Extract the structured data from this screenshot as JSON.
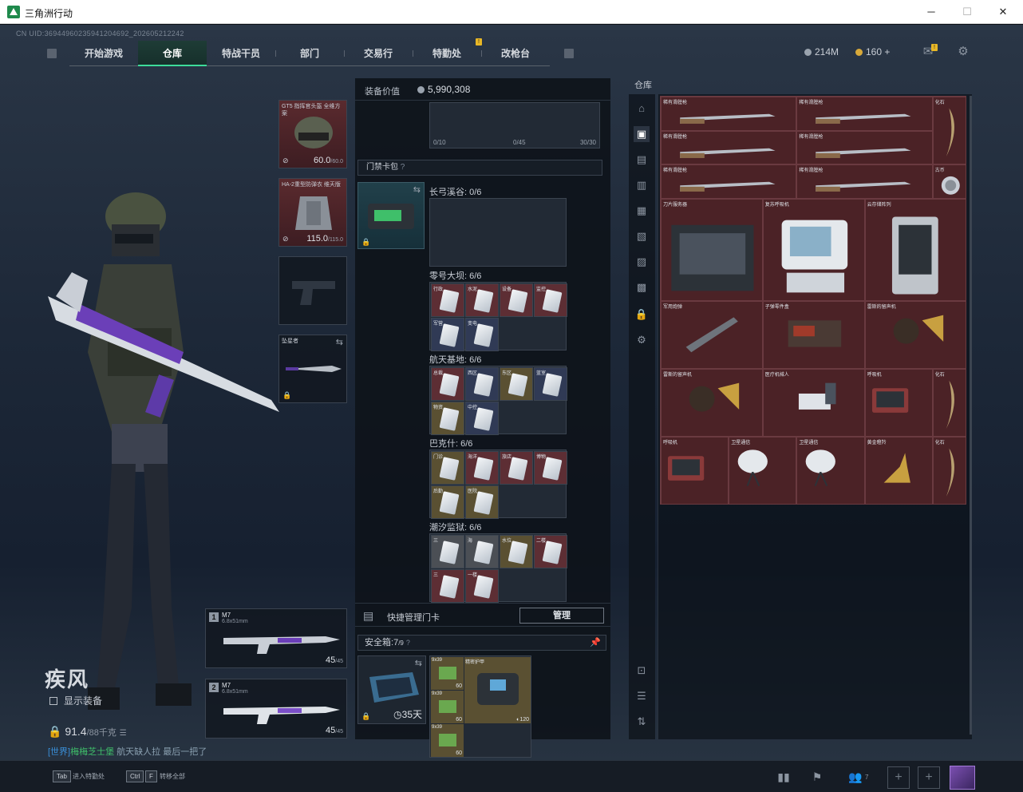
{
  "window": {
    "title": "三角洲行动",
    "minimize": "─",
    "maximize": "☐",
    "close": "✕"
  },
  "uid": "CN UID:3694496023594120469​2_202605212242",
  "nav": {
    "tabs": [
      {
        "label": "开始游戏"
      },
      {
        "label": "仓库"
      },
      {
        "label": "特战干员"
      },
      {
        "label": "部门"
      },
      {
        "label": "交易行"
      },
      {
        "label": "特勤处"
      },
      {
        "label": "改枪台"
      }
    ],
    "badge": "!"
  },
  "currency": {
    "silver": "214M",
    "gold": "160",
    "gold_plus": "+"
  },
  "operator": {
    "name": "疾风",
    "show_equipment": "显示装备",
    "weight": "91.4",
    "weight_max": "/88千克"
  },
  "chat": {
    "channel": "[世界]",
    "user": "梅梅芝士堡",
    "message": "航天缺人拉  最后一把了"
  },
  "equipment": {
    "helmet": {
      "name": "GT5 指挥官头盔 全维方案",
      "durability": "60.0",
      "max": "/60.0"
    },
    "armor": {
      "name": "HA-2重型防弹衣 维天版",
      "durability": "115.0",
      "max": "/115.0"
    },
    "melee": {
      "name": "坠星者"
    },
    "primary": {
      "slot": "1",
      "name": "M7",
      "caliber": "6.8x51mm",
      "ammo": "45",
      "max": "/45"
    },
    "secondary": {
      "slot": "2",
      "name": "M7",
      "caliber": "6.8x51mm",
      "ammo": "45",
      "max": "/45"
    }
  },
  "mid": {
    "value_label": "装备价值",
    "value": "5,990,308",
    "top_counts": [
      "0/10",
      "0/45",
      "30/30"
    ],
    "keycard_bag": "门禁卡包",
    "info": "?",
    "categories": [
      {
        "title": "长弓溪谷: 0/6",
        "cards": []
      },
      {
        "title": "零号大坝: 6/6",
        "cards": [
          {
            "name": "行政",
            "tone": "r"
          },
          {
            "name": "水泥",
            "tone": "r"
          },
          {
            "name": "设备",
            "tone": "r"
          },
          {
            "name": "监控",
            "tone": "r"
          },
          {
            "name": "军营",
            "tone": "b"
          },
          {
            "name": "变电",
            "tone": "b"
          }
        ]
      },
      {
        "title": "航天基地: 6/6",
        "cards": [
          {
            "name": "总裁",
            "tone": "r"
          },
          {
            "name": "西区",
            "tone": "b"
          },
          {
            "name": "东区",
            "tone": "g"
          },
          {
            "name": "蓝室",
            "tone": "b"
          },
          {
            "name": "物资",
            "tone": "g"
          },
          {
            "name": "中控",
            "tone": "b"
          }
        ]
      },
      {
        "title": "巴克什: 6/6",
        "cards": [
          {
            "name": "门诊",
            "tone": "g"
          },
          {
            "name": "海洋",
            "tone": "r"
          },
          {
            "name": "旅店",
            "tone": "r"
          },
          {
            "name": "博物",
            "tone": "r"
          },
          {
            "name": "后勤",
            "tone": "g"
          },
          {
            "name": "医院",
            "tone": "g"
          }
        ]
      },
      {
        "title": "潮汐监狱: 6/6",
        "cards": [
          {
            "name": "三",
            "tone": "w"
          },
          {
            "name": "海",
            "tone": "w"
          },
          {
            "name": "水位",
            "tone": "g"
          },
          {
            "name": "二楼",
            "tone": "r"
          },
          {
            "name": "三",
            "tone": "r"
          },
          {
            "name": "一楼",
            "tone": "r"
          }
        ]
      }
    ],
    "quick_manage": "快捷管理门卡",
    "manage_btn": "管理",
    "safe_label": "安全箱:",
    "safe_count": "7",
    "safe_max": "/9",
    "safe_days": "35天",
    "safe_items": [
      {
        "name": "9x39",
        "qty": "60"
      },
      {
        "name": "9x39",
        "qty": "60"
      },
      {
        "name": "9x39",
        "qty": "60"
      }
    ],
    "armor_plate": {
      "name": "精密护甲",
      "qty": "120"
    }
  },
  "warehouse": {
    "label": "仓库",
    "items": [
      {
        "name": "稀有滑膛枪"
      },
      {
        "name": "稀有滑膛枪"
      },
      {
        "name": "化石"
      },
      {
        "name": "稀有滑膛枪"
      },
      {
        "name": "稀有滑膛枪"
      },
      {
        "name": "稀有滑膛枪"
      },
      {
        "name": "稀有滑膛枪"
      },
      {
        "name": "古币"
      },
      {
        "name": "刀片服务器"
      },
      {
        "name": "复苏呼吸机"
      },
      {
        "name": "云存储阵列"
      },
      {
        "name": "军用炮弹"
      },
      {
        "name": "子弹零件盒"
      },
      {
        "name": "雷斯的留声机"
      },
      {
        "name": "雷斯的留声机"
      },
      {
        "name": "医疗机械人"
      },
      {
        "name": "呼吸机"
      },
      {
        "name": "化石"
      },
      {
        "name": "呼吸机"
      },
      {
        "name": "卫星通信"
      },
      {
        "name": "卫星通信"
      },
      {
        "name": "黄金瞪羚"
      },
      {
        "name": "化石"
      }
    ]
  },
  "bottom": {
    "tab_key": "Tab",
    "tab_label": "进入特勤处",
    "ctrl_key": "Ctrl",
    "f_key": "F",
    "ctrl_label": "转移全部",
    "friends": "7",
    "plus": "+"
  }
}
